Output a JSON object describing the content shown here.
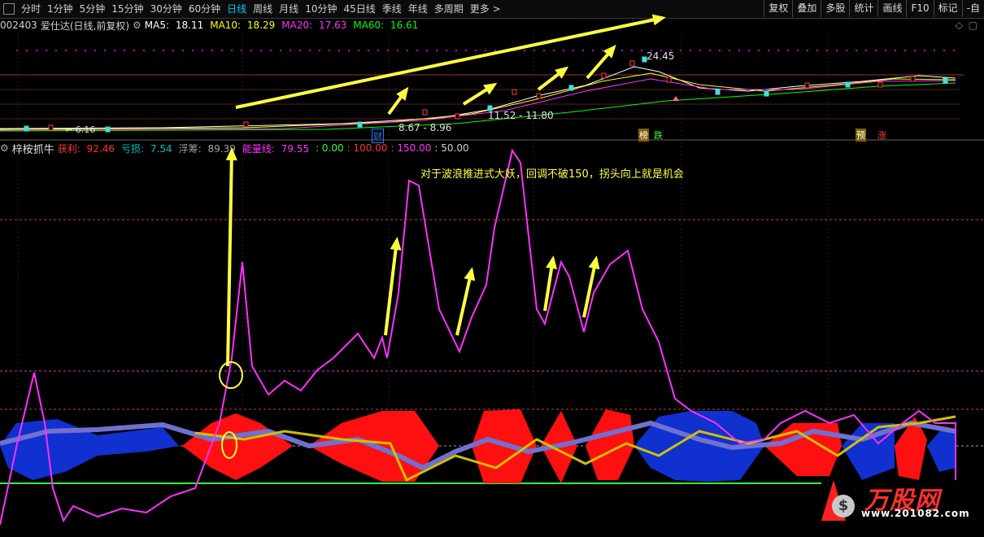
{
  "toolbar": {
    "menu_icon": "window-icon",
    "periods": [
      "分时",
      "1分钟",
      "5分钟",
      "15分钟",
      "30分钟",
      "60分钟",
      "日线",
      "周线",
      "月线",
      "10分钟",
      "45日线",
      "季线",
      "年线",
      "多周期",
      "更多"
    ],
    "active_period": "日线",
    "more_arrow": ">",
    "right_items": [
      "复权",
      "叠加",
      "多股",
      "统计",
      "画线",
      "F10",
      "标记",
      "-自"
    ]
  },
  "info": {
    "code": "002403",
    "name": "爱仕达",
    "mode": "(日线,前复权)",
    "ma5_label": "MA5:",
    "ma5": "18.11",
    "ma10_label": "MA10:",
    "ma10": "18.29",
    "ma20_label": "MA20:",
    "ma20": "17.63",
    "ma60_label": "MA60:",
    "ma60": "16.61",
    "right_icons": [
      "diamond-icon",
      "square-icon"
    ]
  },
  "price_chart": {
    "high_label": "24.45",
    "low_label": "6.16",
    "range_label_1": "11.52 - 11.80",
    "range_label_2": "8.67 - 8.96",
    "tag_cai": "财",
    "tag_bang": "榜",
    "tag_die": "跌",
    "tag_yu": "预",
    "tag_zhang": "涨"
  },
  "indicator": {
    "name": "梓桉抓牛",
    "profit_label": "获利:",
    "profit": "92.46",
    "loss_label": "亏损:",
    "loss": "7.54",
    "float_label": "浮筹:",
    "float": "89.39",
    "energy_label": "能量线:",
    "energy": "79.55",
    "v0": ": 0.00",
    "v100": ": 100.00",
    "v150": ": 150.00",
    "v50": ": 50.00",
    "annotation": "对于波浪推进式大妖，回调不破150，拐头向上就是机会"
  },
  "watermark": {
    "brand": "万股网",
    "url": "www.201082.com"
  },
  "colors": {
    "energy": "#ff30ff",
    "profit": "#ff3030",
    "loss": "#00c0c0",
    "ma5": "#ffffff",
    "ma10": "#ffff00",
    "ma20": "#ff30ff",
    "ma60": "#00ff00",
    "arrow": "#ffff40"
  }
}
